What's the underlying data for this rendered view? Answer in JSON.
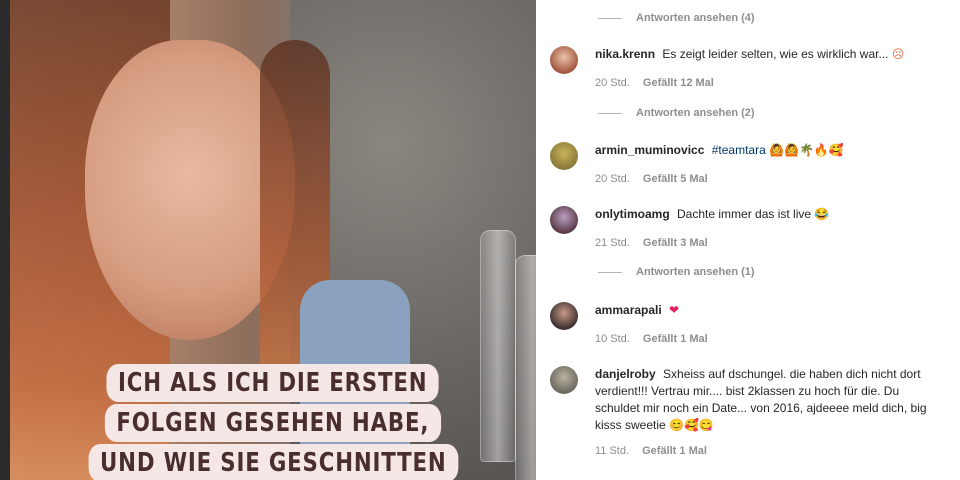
{
  "video": {
    "caption_lines": [
      "ICH ALS ICH DIE ERSTEN",
      "FOLGEN GESEHEN HABE,",
      "UND WIE SIE GESCHNITTEN"
    ]
  },
  "comments_panel": {
    "view_replies": [
      "Antworten ansehen (4)",
      "Antworten ansehen (2)",
      "Antworten ansehen (1)"
    ],
    "comments": [
      {
        "user": "nika.krenn",
        "text": "Es zeigt leider selten, wie es wirklich war...",
        "emoji": "☹",
        "time": "20 Std.",
        "likes": "Gefällt 12 Mal",
        "avatar_color": "#a3573f"
      },
      {
        "user": "armin_muminovicc",
        "tag": "#teamtara",
        "emoji": "🙆🙆🌴🔥🥰",
        "time": "20 Std.",
        "likes": "Gefällt 5 Mal",
        "avatar_color": "#8a7a3a"
      },
      {
        "user": "onlytimoamg",
        "text": "Dachte immer das ist live",
        "emoji": "😂",
        "time": "21 Std.",
        "likes": "Gefällt 3 Mal",
        "avatar_color": "#5b3a4a"
      },
      {
        "user": "ammarapali",
        "emoji": "❤",
        "time": "10 Std.",
        "likes": "Gefällt 1 Mal",
        "avatar_color": "#3d3030"
      },
      {
        "user": "danjelroby",
        "text": "Sxheiss auf dschungel. die haben dich nicht dort verdient!!! Vertrau mir.... bist 2klassen zu hoch für die. Du schuldet mir noch ein Date... von 2016, ajdeeee meld dich, big kisss sweetie",
        "emoji": "😊🥰😋",
        "time": "11 Std.",
        "likes": "Gefällt 1 Mal",
        "avatar_color": "#6e6a60"
      }
    ]
  }
}
